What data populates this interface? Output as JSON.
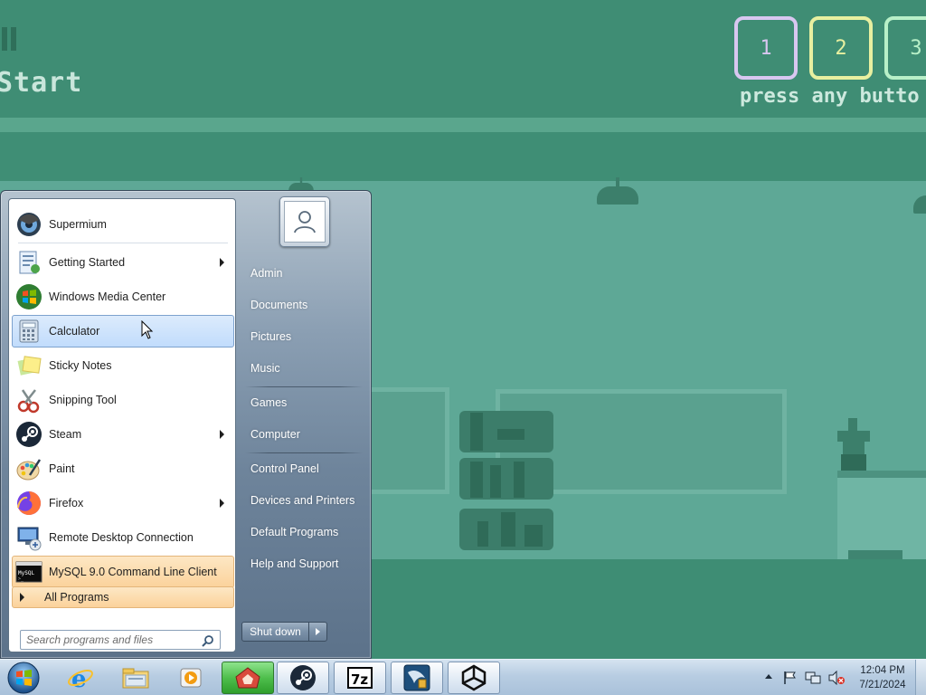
{
  "game": {
    "title_fragment": "Start",
    "players": [
      {
        "label": "1",
        "color": "#d8c7f0"
      },
      {
        "label": "2",
        "color": "#e8f0a0"
      },
      {
        "label": "3",
        "color": "#b8f0c8"
      }
    ],
    "press_text": "press any butto"
  },
  "start_menu": {
    "programs": [
      {
        "label": "Supermium",
        "icon": "supermium-icon",
        "has_submenu": false
      },
      {
        "label": "Getting Started",
        "icon": "getting-started-icon",
        "has_submenu": true
      },
      {
        "label": "Windows Media Center",
        "icon": "media-center-icon",
        "has_submenu": false
      },
      {
        "label": "Calculator",
        "icon": "calculator-icon",
        "has_submenu": false,
        "hovered": true
      },
      {
        "label": "Sticky Notes",
        "icon": "sticky-notes-icon",
        "has_submenu": false
      },
      {
        "label": "Snipping Tool",
        "icon": "snipping-tool-icon",
        "has_submenu": false
      },
      {
        "label": "Steam",
        "icon": "steam-icon",
        "has_submenu": true
      },
      {
        "label": "Paint",
        "icon": "paint-icon",
        "has_submenu": false
      },
      {
        "label": "Firefox",
        "icon": "firefox-icon",
        "has_submenu": true
      },
      {
        "label": "Remote Desktop Connection",
        "icon": "remote-desktop-icon",
        "has_submenu": false
      },
      {
        "label": "MySQL 9.0 Command Line Client",
        "icon": "mysql-client-icon",
        "has_submenu": false,
        "highlighted": true
      }
    ],
    "all_programs_label": "All Programs",
    "search_placeholder": "Search programs and files",
    "places": [
      {
        "label": "Admin"
      },
      {
        "label": "Documents"
      },
      {
        "label": "Pictures"
      },
      {
        "label": "Music"
      },
      {
        "label": "Games"
      },
      {
        "label": "Computer"
      },
      {
        "label": "Control Panel"
      },
      {
        "label": "Devices and Printers"
      },
      {
        "label": "Default Programs"
      },
      {
        "label": "Help and Support"
      }
    ],
    "shutdown_label": "Shut down"
  },
  "taskbar": {
    "pinned": [
      {
        "name": "internet-explorer-icon"
      },
      {
        "name": "file-explorer-icon"
      },
      {
        "name": "media-player-icon"
      },
      {
        "name": "game-app-icon"
      },
      {
        "name": "steam-taskbar-icon"
      },
      {
        "name": "7zip-icon"
      },
      {
        "name": "mysql-workbench-icon"
      },
      {
        "name": "unity-icon"
      }
    ],
    "clock": {
      "time": "12:04 PM",
      "date": "7/21/2024"
    }
  },
  "colors": {
    "game_bg": "#3f8d74",
    "game_room": "#5ea896",
    "hover_blue": "#c1dcfc",
    "highlight_orange": "#fbd29b",
    "taskbar": "#b8cde2"
  }
}
